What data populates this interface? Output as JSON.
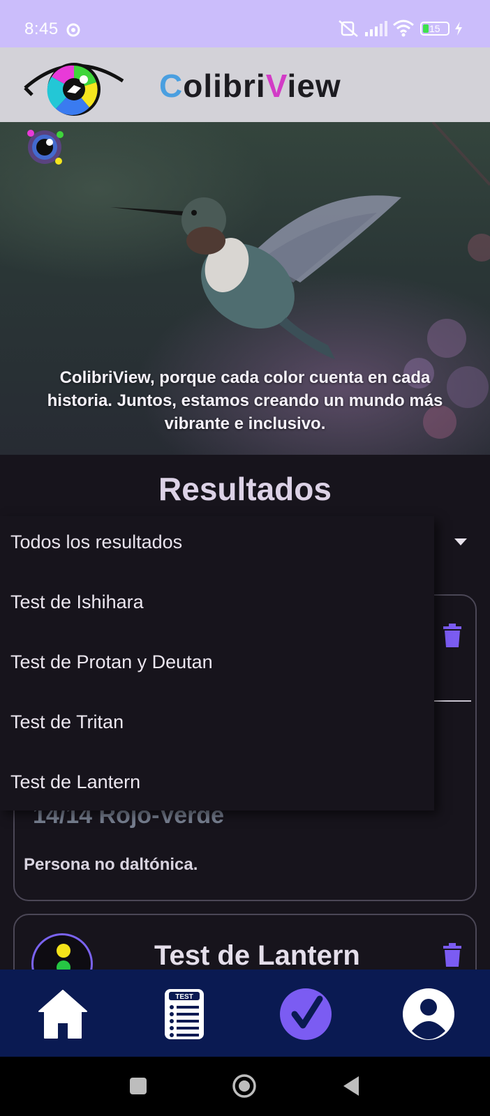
{
  "status_bar": {
    "time": "8:45",
    "battery": "15"
  },
  "app": {
    "brand_c": "C",
    "brand_mid": "olibri",
    "brand_v": "V",
    "brand_end": "iew"
  },
  "hero": {
    "tagline": "ColibriView, porque cada color cuenta en cada historia. Juntos, estamos creando un mundo más vibrante e inclusivo."
  },
  "results": {
    "title": "Resultados",
    "filter": {
      "selected": "Todos los resultados",
      "options": [
        "Test de Ishihara",
        "Test de Protan y Deutan",
        "Test de Tritan",
        "Test de Lantern"
      ]
    },
    "cards": [
      {
        "score": "14/14 Rojo-Verde",
        "diagnosis": "Persona no daltónica."
      },
      {
        "title": "Test de Lantern"
      }
    ]
  },
  "bottom_nav": {
    "items": [
      "home-icon",
      "test-icon",
      "results-check-icon",
      "profile-icon"
    ],
    "test_icon_text": "TEST",
    "active_color": "#7b5cf2"
  },
  "colors": {
    "status_bar": "#cbbdfb",
    "app_bar": "#d3d2d8",
    "background": "#17141c",
    "accent": "#7b5cf2",
    "nav_bar": "#0a1a52"
  }
}
